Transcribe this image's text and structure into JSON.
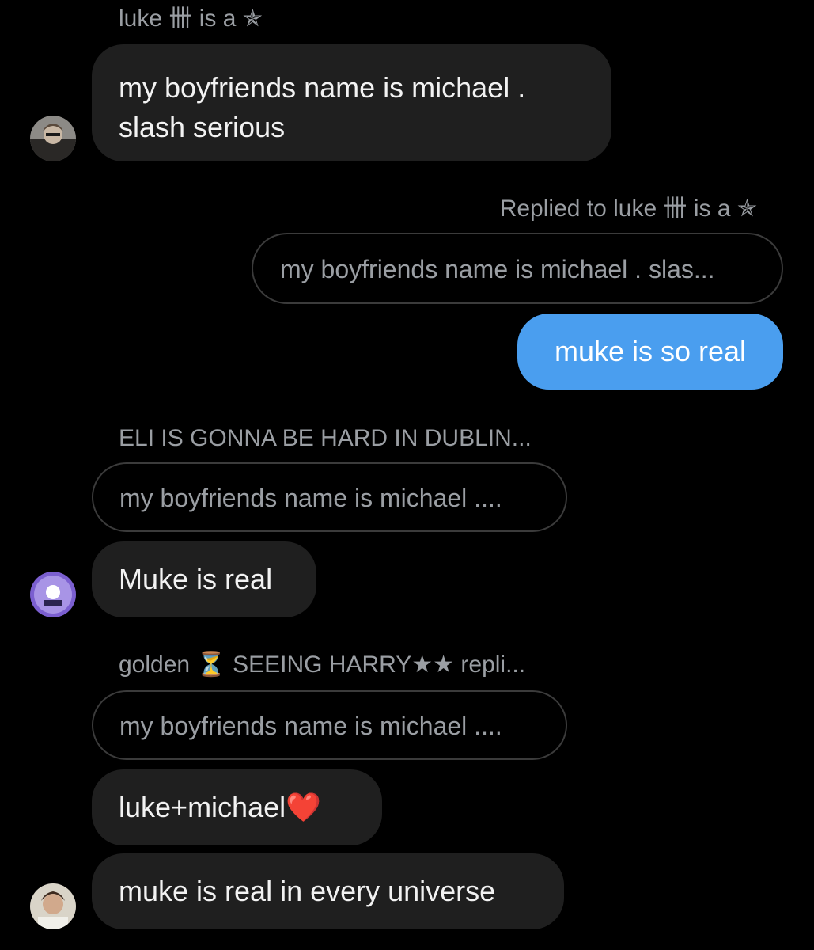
{
  "colors": {
    "background": "#000000",
    "incoming_bubble": "#1f1f1f",
    "outgoing_bubble": "#4a9eef",
    "meta_text": "#9a9ea3",
    "quote_border": "#3b3b3b"
  },
  "messages": {
    "m1": {
      "sender": "luke 卌 is a ✯",
      "line1": "my boyfriends name is michael .",
      "line2": "slash serious",
      "avatar_icon": "avatar-photo-icon"
    },
    "m2": {
      "replied_to": "Replied to luke 卌 is a ✯",
      "quote": "my boyfriends name is michael . slas...",
      "text": "muke is so real"
    },
    "m3": {
      "sender": "ELI IS GONNA BE HARD IN DUBLIN...",
      "quote": "my boyfriends name is michael ....",
      "text": "Muke is real",
      "avatar_icon": "avatar-purple-icon"
    },
    "m4": {
      "sender": "golden ⏳ SEEING HARRY★★ repli...",
      "quote": "my boyfriends name is michael ....",
      "text1": "luke+michael",
      "emoji": "❤️",
      "text2": "muke is real in every universe",
      "avatar_icon": "avatar-photo-icon"
    }
  }
}
